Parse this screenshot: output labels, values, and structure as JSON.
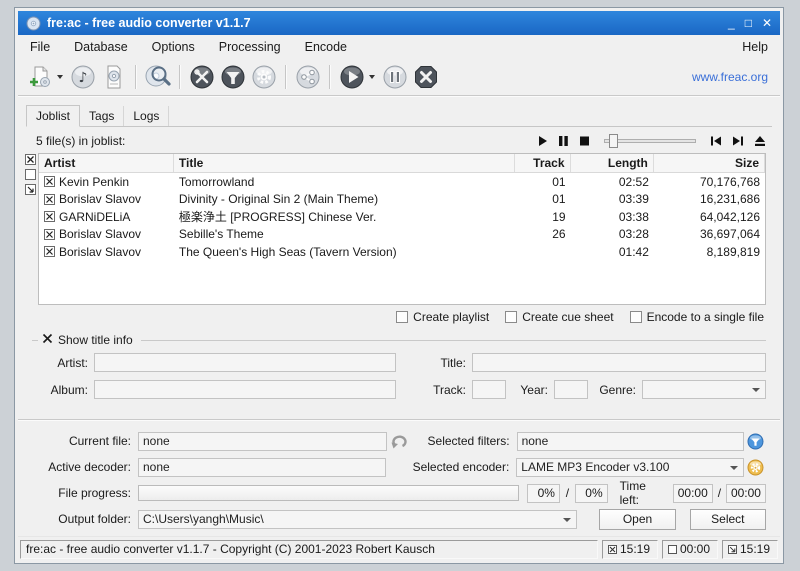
{
  "window": {
    "title": "fre:ac - free audio converter v1.1.7",
    "minimize": "_",
    "maximize": "□",
    "close": "✕"
  },
  "menu": {
    "items": [
      "File",
      "Database",
      "Options",
      "Processing",
      "Encode"
    ],
    "help": "Help"
  },
  "toolbar": {
    "link": "www.freac.org",
    "icons": [
      "add-files",
      "open-audio-file",
      "track-list",
      "cddb-query",
      "configure-tools",
      "filter",
      "settings-gear",
      "share",
      "start-encoding",
      "pause-encoding",
      "stop-encoding"
    ]
  },
  "tabs": {
    "joblist": "Joblist",
    "tags": "Tags",
    "logs": "Logs"
  },
  "joblist": {
    "count_text": "5 file(s) in joblist:",
    "columns": {
      "artist": "Artist",
      "title": "Title",
      "track": "Track",
      "length": "Length",
      "size": "Size"
    },
    "rows": [
      {
        "artist": "Kevin Penkin",
        "title": "Tomorrowland",
        "track": "01",
        "length": "02:52",
        "size": "70,176,768"
      },
      {
        "artist": "Borislav Slavov",
        "title": "Divinity - Original Sin 2 (Main Theme)",
        "track": "01",
        "length": "03:39",
        "size": "16,231,686"
      },
      {
        "artist": "GARNiDELiA",
        "title": "極楽浄土 [PROGRESS] Chinese Ver.",
        "track": "19",
        "length": "03:38",
        "size": "64,042,126"
      },
      {
        "artist": "Borislav Slavov",
        "title": "Sebille's Theme",
        "track": "26",
        "length": "03:28",
        "size": "36,697,064"
      },
      {
        "artist": "Borislav Slavov",
        "title": "The Queen's High Seas (Tavern Version)",
        "track": "",
        "length": "01:42",
        "size": "8,189,819"
      }
    ]
  },
  "options": {
    "create_playlist": "Create playlist",
    "create_cue_sheet": "Create cue sheet",
    "encode_single": "Encode to a single file"
  },
  "title_info": {
    "header": "Show title info",
    "artist": "Artist:",
    "title": "Title:",
    "album": "Album:",
    "track": "Track:",
    "year": "Year:",
    "genre": "Genre:"
  },
  "status_panel": {
    "current_file_label": "Current file:",
    "current_file": "none",
    "active_decoder_label": "Active decoder:",
    "active_decoder": "none",
    "selected_filters_label": "Selected filters:",
    "selected_filters": "none",
    "selected_encoder_label": "Selected encoder:",
    "selected_encoder": "LAME MP3 Encoder v3.100",
    "file_progress_label": "File progress:",
    "percent_file": "0%",
    "percent_total": "0%",
    "slash": "/",
    "time_left_label": "Time left:",
    "time_file": "00:00",
    "time_total": "00:00",
    "output_folder_label": "Output folder:",
    "output_folder": "C:\\Users\\yangh\\Music\\",
    "open": "Open",
    "select": "Select"
  },
  "statusbar": {
    "text": "fre:ac - free audio converter v1.1.7 - Copyright (C) 2001-2023 Robert Kausch",
    "time1": "15:19",
    "time2": "00:00",
    "time3": "15:19"
  },
  "colors": {
    "titlebar": "#1e74d2",
    "link": "#3a6fd8",
    "filter_icon_blue": "#4d96dd",
    "encoder_icon_gold": "#eebd4e"
  }
}
